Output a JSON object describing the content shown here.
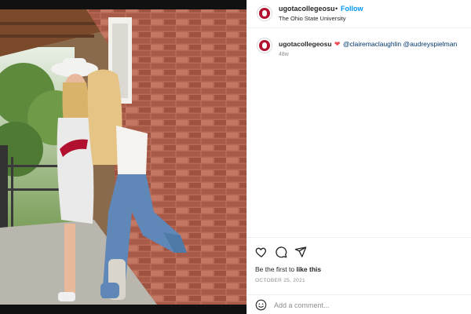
{
  "post": {
    "author": {
      "username": "ugotacollegeosu",
      "follow_label": "Follow",
      "separator": "•",
      "location": "The Ohio State University",
      "more_label": "•••"
    },
    "caption": {
      "username": "ugotacollegeosu",
      "heart": "❤",
      "mentions": [
        "@clairemaclaughlin",
        "@audreyspielman"
      ],
      "time_ago": "48w"
    },
    "actions": {
      "like_icon": "heart-outline-icon",
      "comment_icon": "comment-bubble-icon",
      "share_icon": "paper-plane-icon"
    },
    "likes": {
      "prefix": "Be the first to ",
      "bold": "like this"
    },
    "date": "OCTOBER 25, 2021",
    "comment_box": {
      "emoji_icon": "smiley-icon",
      "placeholder": "Add a comment..."
    }
  },
  "colors": {
    "follow_blue": "#0095f6",
    "heart_red": "#ed4956",
    "mention_blue": "#00376b",
    "osu_scarlet": "#b2102f"
  }
}
